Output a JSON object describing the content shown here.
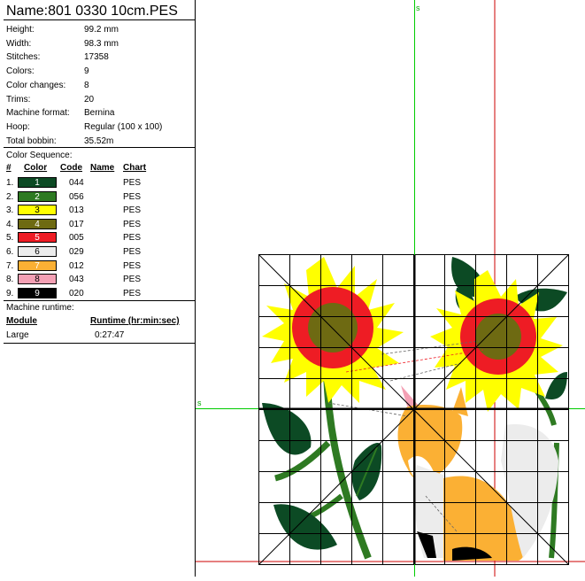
{
  "file": {
    "name_label": "Name:801 0330 10cm.PES"
  },
  "info": [
    {
      "key": "Height:",
      "value": "99.2 mm"
    },
    {
      "key": "Width:",
      "value": "98.3 mm"
    },
    {
      "key": "Stitches:",
      "value": "17358"
    },
    {
      "key": "Colors:",
      "value": "9"
    },
    {
      "key": "Color changes:",
      "value": "8"
    },
    {
      "key": "Trims:",
      "value": "20"
    },
    {
      "key": "Machine format:",
      "value": "Bernina"
    },
    {
      "key": "Hoop:",
      "value": "Regular (100 x 100)"
    },
    {
      "key": "Total bobbin:",
      "value": "35.52m"
    }
  ],
  "color_sequence": {
    "title": "Color Sequence:",
    "headers": {
      "num": "#",
      "color": "Color",
      "code": "Code",
      "name": "Name",
      "chart": "Chart"
    },
    "rows": [
      {
        "num": "1.",
        "swatch": "1",
        "color": "#0c4a24",
        "text": "#ffffff",
        "code": "044",
        "chart": "PES"
      },
      {
        "num": "2.",
        "swatch": "2",
        "color": "#2e7a22",
        "text": "#ffffff",
        "code": "056",
        "chart": "PES"
      },
      {
        "num": "3.",
        "swatch": "3",
        "color": "#ffff00",
        "text": "#000000",
        "code": "013",
        "chart": "PES"
      },
      {
        "num": "4.",
        "swatch": "4",
        "color": "#6e6a12",
        "text": "#ffffff",
        "code": "017",
        "chart": "PES"
      },
      {
        "num": "5.",
        "swatch": "5",
        "color": "#ee1c24",
        "text": "#ffffff",
        "code": "005",
        "chart": "PES"
      },
      {
        "num": "6.",
        "swatch": "6",
        "color": "#ececec",
        "text": "#000000",
        "code": "029",
        "chart": "PES"
      },
      {
        "num": "7.",
        "swatch": "7",
        "color": "#fbb034",
        "text": "#ffffff",
        "code": "012",
        "chart": "PES"
      },
      {
        "num": "8.",
        "swatch": "8",
        "color": "#f4a0b4",
        "text": "#000000",
        "code": "043",
        "chart": "PES"
      },
      {
        "num": "9.",
        "swatch": "9",
        "color": "#000000",
        "text": "#ffffff",
        "code": "020",
        "chart": "PES"
      }
    ]
  },
  "runtime": {
    "title": "Machine runtime:",
    "headers": {
      "module": "Module",
      "runtime": "Runtime (hr:min:sec)"
    },
    "rows": [
      {
        "module": "Large",
        "time": "0:27:47"
      }
    ]
  },
  "canvas": {
    "axis_label_top": "s",
    "axis_label_left": "s",
    "guide_color": "#00cc00",
    "ref_color": "#cc0000"
  }
}
